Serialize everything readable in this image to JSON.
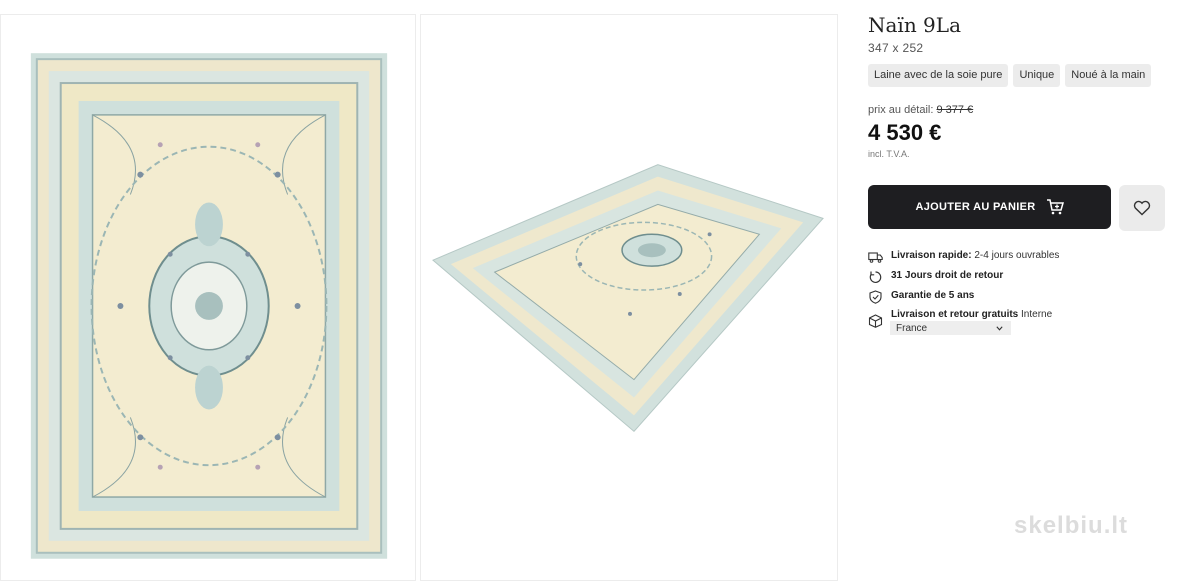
{
  "gallery": {
    "images": [
      {
        "alt_icon": "rug-top-view"
      },
      {
        "alt_icon": "rug-perspective-view"
      }
    ]
  },
  "product": {
    "title": "Naïn 9La",
    "dimensions": "347 x 252",
    "tags": [
      "Laine avec de la soie pure",
      "Unique",
      "Noué à la main"
    ],
    "retail_label": "prix au détail:",
    "retail_price": "9 377 €",
    "price": "4 530 €",
    "vat_note": "incl. T.V.A."
  },
  "actions": {
    "add_to_cart": "AJOUTER AU PANIER",
    "cart_icon": "cart-plus-icon",
    "wishlist_icon": "heart-icon"
  },
  "perks": {
    "fast_delivery_bold": "Livraison rapide:",
    "fast_delivery_rest": "2-4 jours ouvrables",
    "returns": "31 Jours droit de retour",
    "guarantee": "Garantie de 5 ans",
    "free_shipping_bold": "Livraison et retour gratuits",
    "free_shipping_rest": "Interne",
    "country_selected": "France"
  },
  "watermark": "skelbiu.lt",
  "colors": {
    "button_dark": "#1e1e21",
    "tag_bg": "#ececec",
    "rug_cream": "#f3ecd0",
    "rug_blue": "#c7dbd9"
  }
}
